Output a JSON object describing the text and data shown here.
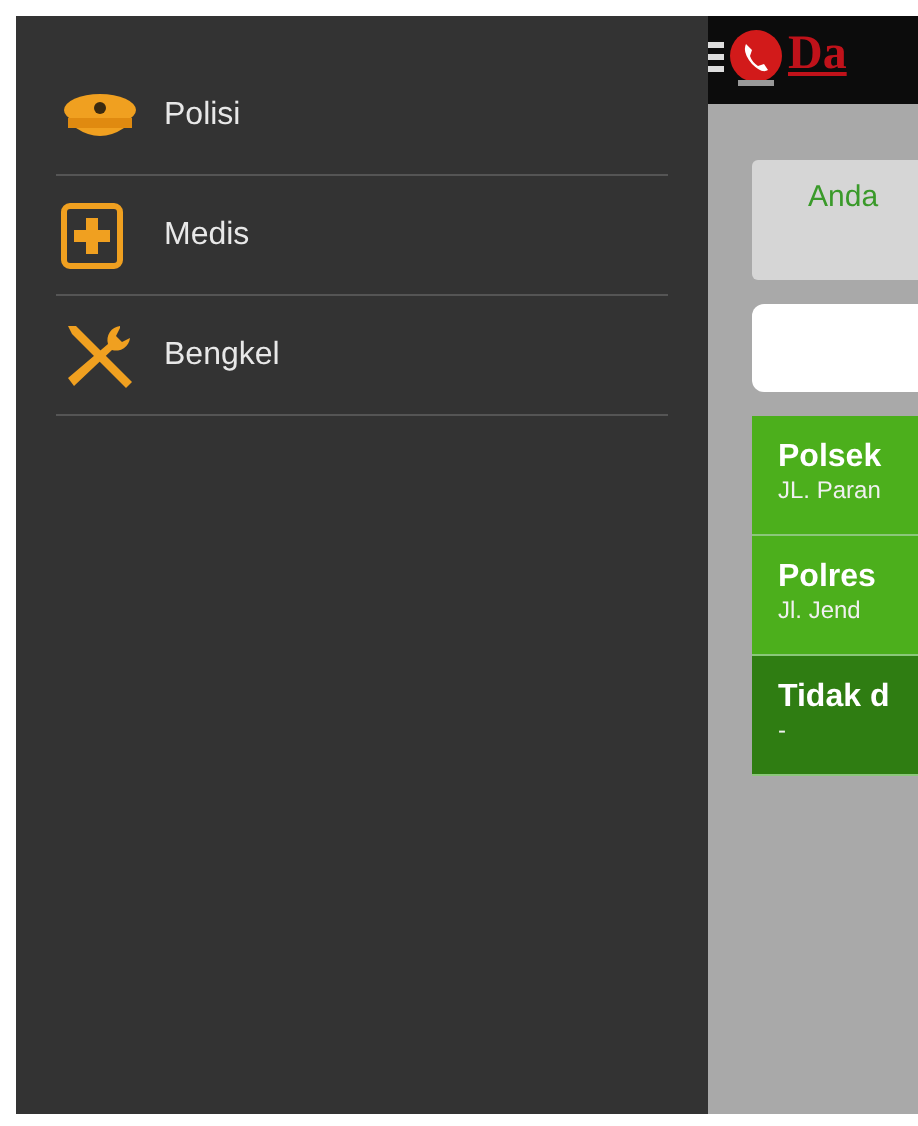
{
  "drawer": {
    "items": [
      {
        "label": "Polisi",
        "kind": "police"
      },
      {
        "label": "Medis",
        "kind": "medical"
      },
      {
        "label": "Bengkel",
        "kind": "repair"
      }
    ]
  },
  "header": {
    "title": "Da"
  },
  "notice": {
    "text": "Anda"
  },
  "results": [
    {
      "name": "Polsek",
      "address": "JL. Paran",
      "color": "#4caf1c"
    },
    {
      "name": "Polres",
      "address": "Jl. Jend",
      "color": "#4caf1c"
    },
    {
      "name": "Tidak d",
      "address": "-",
      "color": "#2f7d12"
    }
  ]
}
